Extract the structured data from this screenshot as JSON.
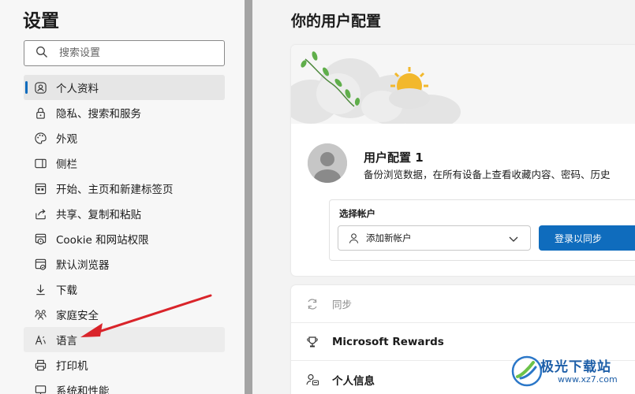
{
  "sidebar": {
    "title": "设置",
    "search": {
      "placeholder": "搜索设置"
    },
    "items": [
      {
        "label": "个人资料",
        "icon": "profile-icon"
      },
      {
        "label": "隐私、搜索和服务",
        "icon": "lock-icon"
      },
      {
        "label": "外观",
        "icon": "palette-icon"
      },
      {
        "label": "侧栏",
        "icon": "sidebar-icon"
      },
      {
        "label": "开始、主页和新建标签页",
        "icon": "home-icon"
      },
      {
        "label": "共享、复制和粘贴",
        "icon": "share-icon"
      },
      {
        "label": "Cookie 和网站权限",
        "icon": "cookie-icon"
      },
      {
        "label": "默认浏览器",
        "icon": "browser-icon"
      },
      {
        "label": "下载",
        "icon": "download-icon"
      },
      {
        "label": "家庭安全",
        "icon": "family-icon"
      },
      {
        "label": "语言",
        "icon": "language-icon"
      },
      {
        "label": "打印机",
        "icon": "printer-icon"
      },
      {
        "label": "系统和性能",
        "icon": "system-icon"
      }
    ]
  },
  "main": {
    "title": "你的用户配置",
    "profile": {
      "name": "用户配置 1",
      "description": "备份浏览数据，在所有设备上查看收藏内容、密码、历史"
    },
    "account": {
      "label": "选择帐户",
      "select_value": "添加新帐户",
      "signin_button": "登录以同步"
    },
    "rows": [
      {
        "label": "同步",
        "icon": "sync-icon"
      },
      {
        "label": "Microsoft Rewards",
        "icon": "trophy-icon"
      },
      {
        "label": "个人信息",
        "icon": "person-card-icon"
      }
    ]
  },
  "watermark": {
    "text": "极光下载站",
    "url": "www.xz7.com"
  },
  "colors": {
    "accent": "#0f6cbd",
    "annotation_arrow": "#d9242a",
    "watermark": "#1e5fa8"
  }
}
